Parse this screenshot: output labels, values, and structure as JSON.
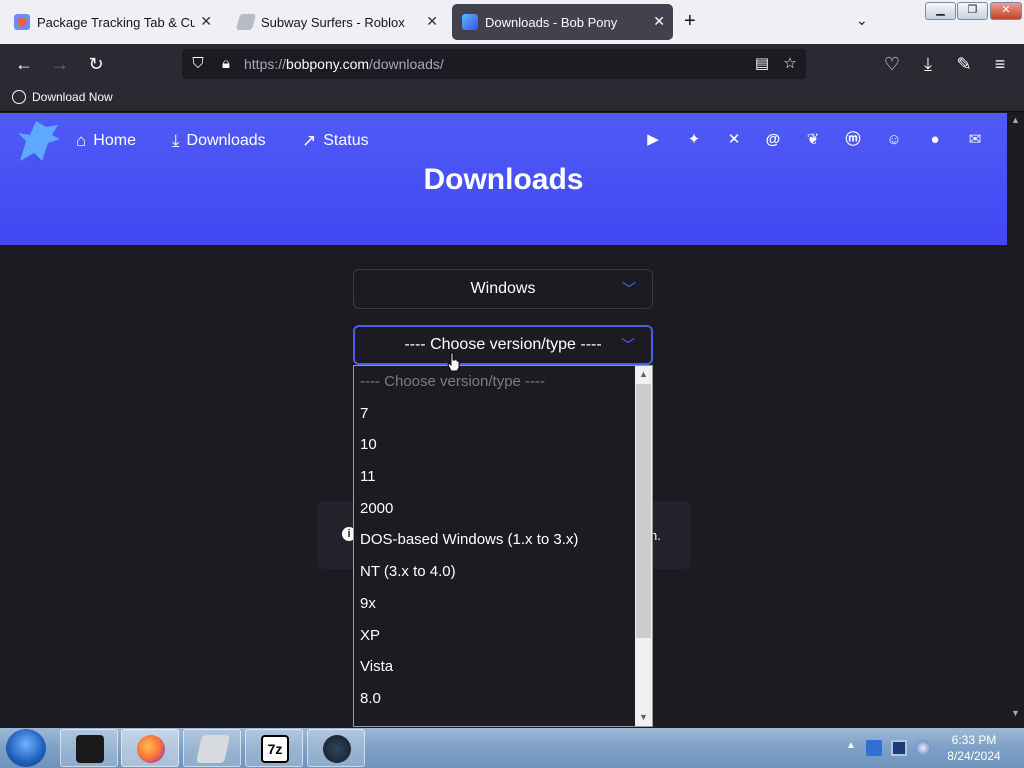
{
  "browser": {
    "tabs": [
      {
        "title": "Package Tracking Tab & Custom",
        "active": false
      },
      {
        "title": "Subway Surfers - Roblox",
        "active": false
      },
      {
        "title": "Downloads - Bob Pony",
        "active": true
      }
    ],
    "url_scheme": "https://",
    "url_host": "bobpony.com",
    "url_path": "/downloads/",
    "bookmark": "Download Now"
  },
  "site": {
    "nav": [
      {
        "label": "Home",
        "icon": "home-icon"
      },
      {
        "label": "Downloads",
        "icon": "download-icon"
      },
      {
        "label": "Status",
        "icon": "trending-icon"
      }
    ],
    "social_icons": [
      "youtube-icon",
      "twitter-icon",
      "x-icon",
      "threads-icon",
      "bluesky-icon",
      "mastodon-icon",
      "discord-icon",
      "github-icon",
      "email-icon"
    ],
    "title": "Downloads",
    "brand_color": "#4a55f5"
  },
  "form": {
    "os_select_value": "Windows",
    "version_select_value": "---- Choose version/type ----",
    "options": [
      "---- Choose version/type ----",
      "7",
      "10",
      "11",
      "2000",
      "DOS-based Windows (1.x to 3.x)",
      "NT (3.x to 4.0)",
      "9x",
      "XP",
      "Vista",
      "8.0"
    ],
    "info_tail": "n."
  },
  "taskbar": {
    "time": "6:33 PM",
    "date": "8/24/2024"
  }
}
